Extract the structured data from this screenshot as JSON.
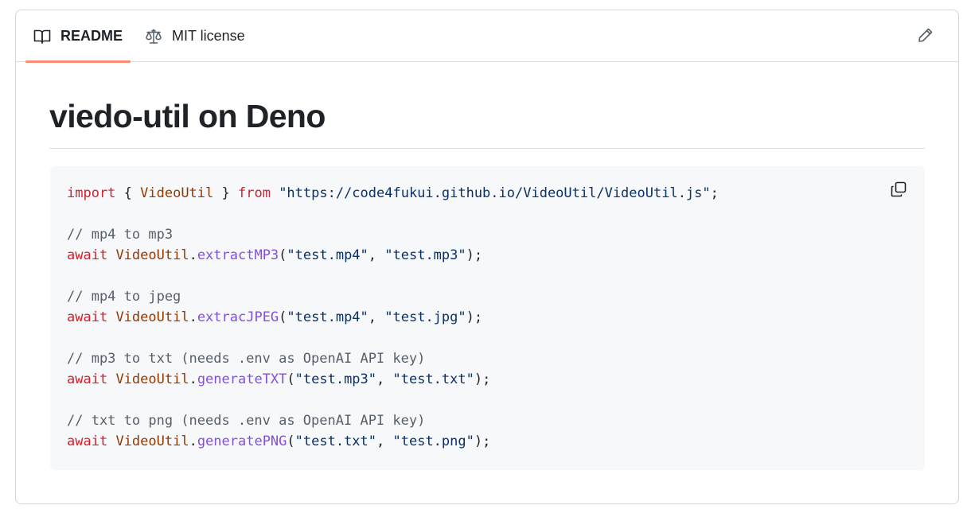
{
  "tabs": [
    {
      "label": "README",
      "icon": "book-icon",
      "active": true
    },
    {
      "label": "MIT license",
      "icon": "scale-icon",
      "active": false
    }
  ],
  "colors": {
    "active_tab_underline": "#fd8c73",
    "keyword": "#cf222e",
    "identifier": "#953800",
    "function": "#8250df",
    "string": "#0a3069",
    "comment": "#57606a",
    "code_bg": "#f6f8fa"
  },
  "readme": {
    "title": "viedo-util on Deno",
    "code": {
      "line1": {
        "kw1": "import",
        "p1": " { ",
        "id": "VideoUtil",
        "p2": " } ",
        "kw2": "from",
        "p3": " ",
        "str": "\"https://code4fukui.github.io/VideoUtil/VideoUtil.js\"",
        "end": ";"
      },
      "comment1": "// mp4 to mp3",
      "call1": {
        "kw": "await",
        "obj": "VideoUtil",
        "dot": ".",
        "fn": "extractMP3",
        "open": "(",
        "arg1": "\"test.mp4\"",
        "sep": ", ",
        "arg2": "\"test.mp3\"",
        "close": ");"
      },
      "comment2": "// mp4 to jpeg",
      "call2": {
        "kw": "await",
        "obj": "VideoUtil",
        "dot": ".",
        "fn": "extracJPEG",
        "open": "(",
        "arg1": "\"test.mp4\"",
        "sep": ", ",
        "arg2": "\"test.jpg\"",
        "close": ");"
      },
      "comment3": "// mp3 to txt (needs .env as OpenAI API key)",
      "call3": {
        "kw": "await",
        "obj": "VideoUtil",
        "dot": ".",
        "fn": "generateTXT",
        "open": "(",
        "arg1": "\"test.mp3\"",
        "sep": ", ",
        "arg2": "\"test.txt\"",
        "close": ");"
      },
      "comment4": "// txt to png (needs .env as OpenAI API key)",
      "call4": {
        "kw": "await",
        "obj": "VideoUtil",
        "dot": ".",
        "fn": "generatePNG",
        "open": "(",
        "arg1": "\"test.txt\"",
        "sep": ", ",
        "arg2": "\"test.png\"",
        "close": ");"
      }
    }
  },
  "actions": {
    "edit_icon": "pencil-icon",
    "copy_icon": "copy-icon"
  }
}
